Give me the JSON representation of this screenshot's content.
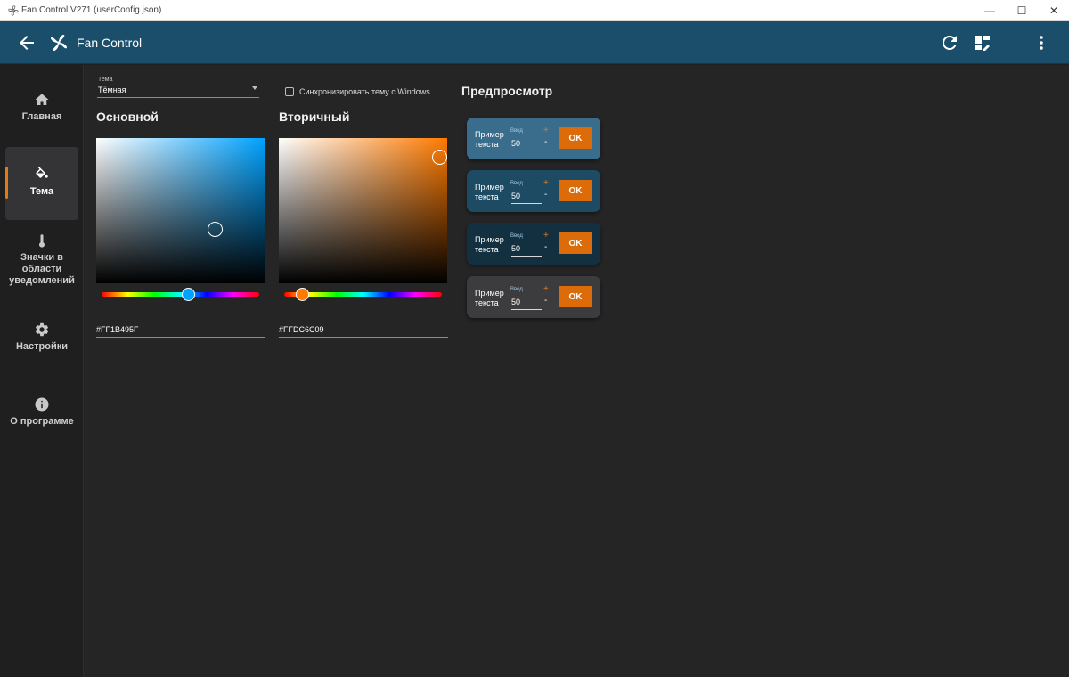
{
  "window": {
    "title": "Fan Control V271 (userConfig.json)",
    "minimize_glyph": "—",
    "maximize_glyph": "☐",
    "close_glyph": "✕"
  },
  "appbar": {
    "title": "Fan Control",
    "icons": [
      "back-arrow-icon",
      "fan-logo-icon",
      "refresh-icon",
      "dashboard-edit-icon",
      "more-vertical-icon"
    ],
    "color": "#1b4e6b"
  },
  "sidebar": {
    "items": [
      {
        "label": "Главная",
        "icon": "home-icon",
        "active": false
      },
      {
        "label": "Тема",
        "icon": "paint-bucket-icon",
        "active": true
      },
      {
        "label": "Значки в области уведомлений",
        "icon": "thermometer-icon",
        "active": false
      },
      {
        "label": "Настройки",
        "icon": "gear-icon",
        "active": false
      },
      {
        "label": "О программе",
        "icon": "info-icon",
        "active": false
      }
    ],
    "active_indicator_color": "#e07a1b"
  },
  "theme": {
    "select_label": "Тема",
    "select_value": "Тёмная",
    "sync_label": "Синхронизировать тему с Windows",
    "sync_checked": false
  },
  "primary": {
    "title": "Основной",
    "hex": "#FF1B495F",
    "hue_color": "#00a2ff"
  },
  "secondary": {
    "title": "Вторичный",
    "hex": "#FFDC6C09",
    "hue_color": "#ff7a00"
  },
  "preview": {
    "title": "Предпросмотр",
    "cards": [
      {
        "text": "Пример текста",
        "input_label": "Ввод",
        "input_value": "50",
        "plus": "+",
        "minus": "-",
        "button": "OK",
        "bg": "#3a6d8c"
      },
      {
        "text": "Пример текста",
        "input_label": "Ввод",
        "input_value": "50",
        "plus": "+",
        "minus": "-",
        "button": "OK",
        "bg": "#1d4b63"
      },
      {
        "text": "Пример текста",
        "input_label": "Ввод",
        "input_value": "50",
        "plus": "+",
        "minus": "-",
        "button": "OK",
        "bg": "#12303f"
      },
      {
        "text": "Пример текста",
        "input_label": "Ввод",
        "input_value": "50",
        "plus": "+",
        "minus": "-",
        "button": "OK",
        "bg": "#3c3c3e"
      }
    ]
  }
}
